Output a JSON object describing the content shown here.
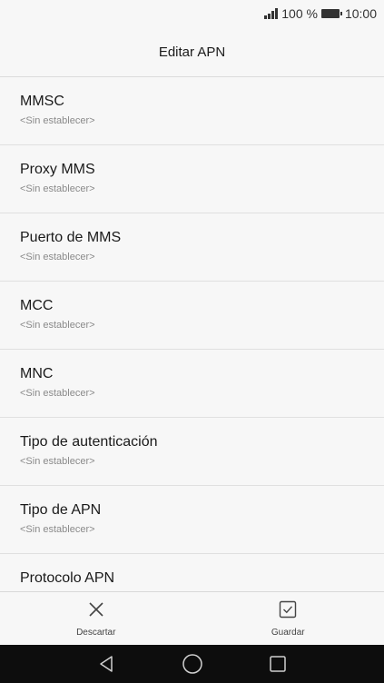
{
  "status_bar": {
    "battery_percent": "100 %",
    "time": "10:00"
  },
  "header": {
    "title": "Editar APN"
  },
  "settings": [
    {
      "label": "MMSC",
      "value": "<Sin establecer>"
    },
    {
      "label": "Proxy MMS",
      "value": "<Sin establecer>"
    },
    {
      "label": "Puerto de MMS",
      "value": "<Sin establecer>"
    },
    {
      "label": "MCC",
      "value": "<Sin establecer>"
    },
    {
      "label": "MNC",
      "value": "<Sin establecer>"
    },
    {
      "label": "Tipo de autenticación",
      "value": "<Sin establecer>"
    },
    {
      "label": "Tipo de APN",
      "value": "<Sin establecer>"
    },
    {
      "label": "Protocolo APN",
      "value": ""
    }
  ],
  "actions": {
    "discard_label": "Descartar",
    "discard_icon": "close-icon",
    "save_label": "Guardar",
    "save_icon": "checkbox-check-icon"
  },
  "nav_bar": {
    "back_icon": "back-triangle-icon",
    "home_icon": "home-circle-icon",
    "recents_icon": "recents-square-icon"
  }
}
